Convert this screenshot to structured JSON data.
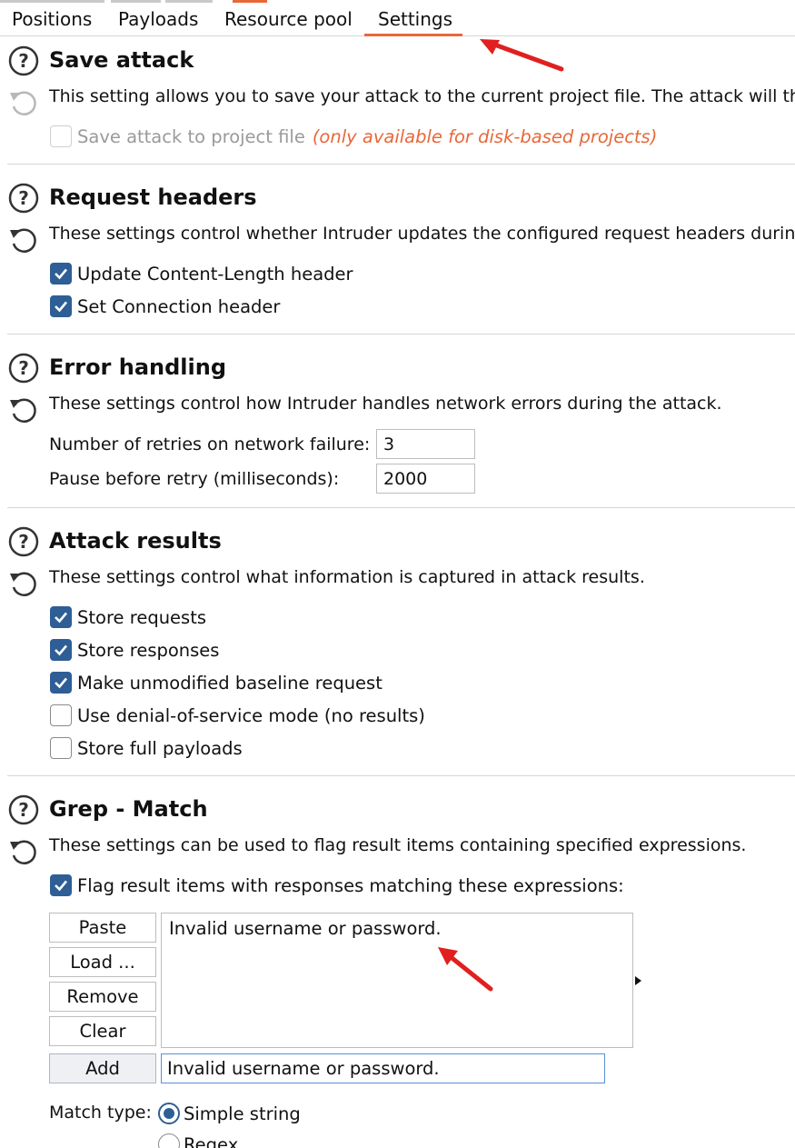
{
  "tabs": [
    {
      "label": "Positions"
    },
    {
      "label": "Payloads"
    },
    {
      "label": "Resource pool"
    },
    {
      "label": "Settings"
    }
  ],
  "save_attack": {
    "title": "Save attack",
    "description": "This setting allows you to save your attack to the current project file. The attack will the",
    "checkbox_label": "Save attack to project file",
    "note": "(only available for disk-based projects)"
  },
  "request_headers": {
    "title": "Request headers",
    "description": "These settings control whether Intruder updates the configured request headers during",
    "options": [
      {
        "label": "Update Content-Length header",
        "checked": true
      },
      {
        "label": "Set Connection header",
        "checked": true
      }
    ]
  },
  "error_handling": {
    "title": "Error handling",
    "description": "These settings control how Intruder handles network errors during the attack.",
    "retries_label": "Number of retries on network failure:",
    "retries_value": "3",
    "pause_label": "Pause before retry (milliseconds):",
    "pause_value": "2000"
  },
  "attack_results": {
    "title": "Attack results",
    "description": "These settings control what information is captured in attack results.",
    "options": [
      {
        "label": "Store requests",
        "checked": true
      },
      {
        "label": "Store responses",
        "checked": true
      },
      {
        "label": "Make unmodified baseline request",
        "checked": true
      },
      {
        "label": "Use denial-of-service mode (no results)",
        "checked": false
      },
      {
        "label": "Store full payloads",
        "checked": false
      }
    ]
  },
  "grep_match": {
    "title": "Grep - Match",
    "description": "These settings can be used to flag result items containing specified expressions.",
    "flag_label": "Flag result items with responses matching these expressions:",
    "buttons": {
      "paste": "Paste",
      "load": "Load ...",
      "remove": "Remove",
      "clear": "Clear",
      "add": "Add"
    },
    "list_items": [
      "Invalid username or password."
    ],
    "add_value": "Invalid username or password.",
    "match_type_label": "Match type:",
    "match_types": [
      {
        "label": "Simple string",
        "selected": true
      },
      {
        "label": "Regex",
        "selected": false
      }
    ]
  },
  "colors": {
    "accent": "#e8683a",
    "checkbox": "#2e5e95",
    "annotation_arrow": "#e0201f"
  },
  "icons": [
    "help-circle-icon",
    "reset-icon",
    "checkmark-icon",
    "annotation-arrow-icon"
  ]
}
